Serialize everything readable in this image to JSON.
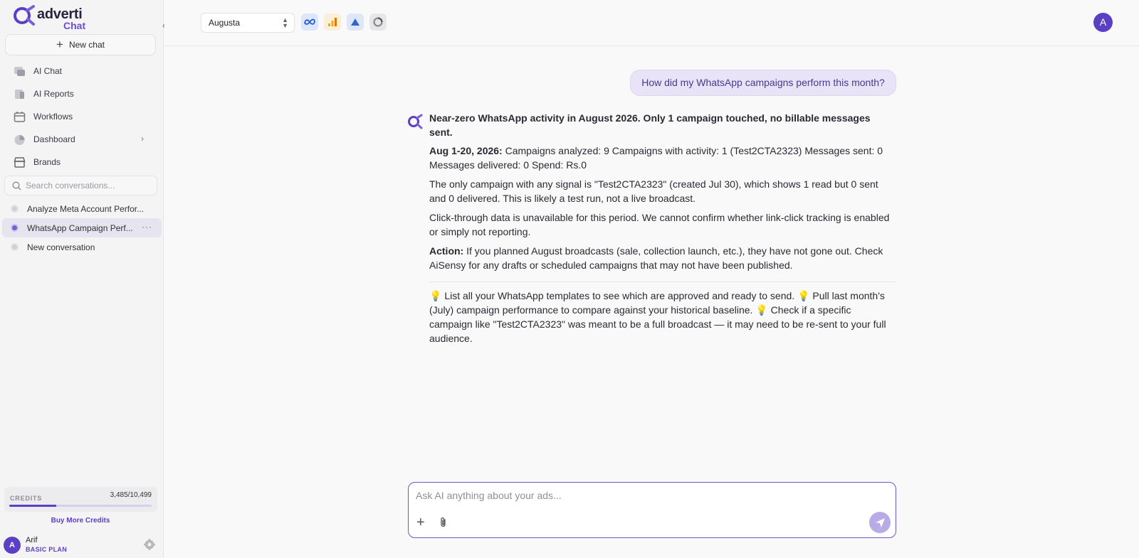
{
  "app": {
    "brand_main": "adverti",
    "brand_sub": "Chat"
  },
  "sidebar": {
    "new_chat_label": "New chat",
    "nav": [
      {
        "label": "AI Chat",
        "icon": "chat-icon"
      },
      {
        "label": "AI Reports",
        "icon": "reports-icon"
      },
      {
        "label": "Workflows",
        "icon": "calendar-icon"
      },
      {
        "label": "Dashboard",
        "icon": "dashboard-icon"
      },
      {
        "label": "Brands",
        "icon": "store-icon"
      }
    ],
    "search_placeholder": "Search conversations...",
    "conversations": [
      {
        "title": "Analyze Meta Account Perfor..."
      },
      {
        "title": "WhatsApp Campaign Perf...",
        "active": true
      },
      {
        "title": "New conversation"
      }
    ],
    "credits": {
      "label": "CREDITS",
      "value_text": "3,485/10,499",
      "used_fraction": 0.332
    },
    "buy_more_label": "Buy More Credits",
    "user": {
      "initial": "A",
      "name": "Arif",
      "plan": "BASIC PLAN"
    }
  },
  "topbar": {
    "brand_select": "Augusta",
    "integrations": [
      "meta-icon",
      "analytics-icon",
      "google-ads-icon",
      "shopify-icon"
    ],
    "user_initial": "A"
  },
  "chat": {
    "user_message": "How did my WhatsApp campaigns perform this month?",
    "ai": {
      "headline": "Near-zero WhatsApp activity in August 2026. Only 1 campaign touched, no billable messages sent.",
      "p1_label": "Aug 1-20, 2026:",
      "p1_text": " Campaigns analyzed: 9 Campaigns with activity: 1 (Test2CTA2323) Messages sent: 0 Messages delivered: 0 Spend: Rs.0",
      "p2": "The only campaign with any signal is \"Test2CTA2323\" (created Jul 30), which shows 1 read but 0 sent and 0 delivered. This is likely a test run, not a live broadcast.",
      "p3": "Click-through data is unavailable for this period. We cannot confirm whether link-click tracking is enabled or simply not reporting.",
      "p4_label": "Action:",
      "p4_text": " If you planned August broadcasts (sale, collection launch, etc.), they have not gone out. Check AiSensy for any drafts or scheduled campaigns that may not have been published.",
      "suggestions": [
        "List all your WhatsApp templates to see which are approved and ready to send.",
        "Pull last month's (July) campaign performance to compare against your historical baseline.",
        "Check if a specific campaign like \"Test2CTA2323\" was meant to be a full broadcast — it may need to be re-sent to your full audience."
      ]
    }
  },
  "composer": {
    "placeholder": "Ask AI anything about your ads..."
  },
  "colors": {
    "accent": "#5b3fc4",
    "bubble": "#e8e3f7"
  }
}
